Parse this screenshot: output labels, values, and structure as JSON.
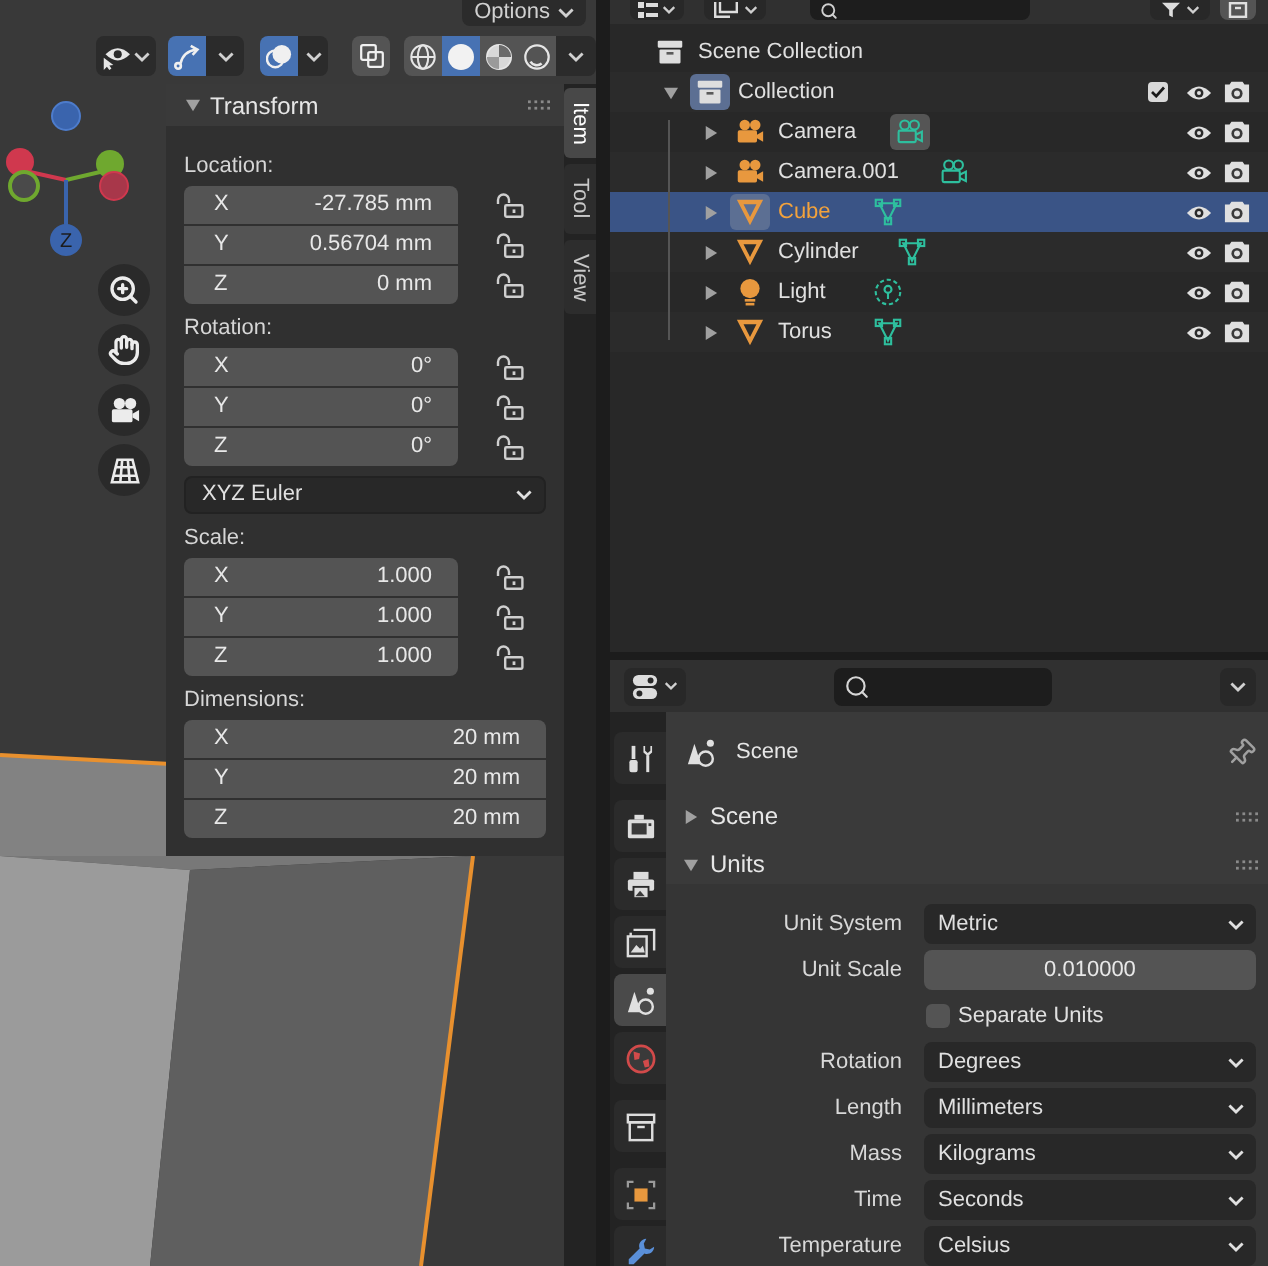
{
  "viewport": {
    "options_label": "Options",
    "toolbar": {
      "gizmo_on": true,
      "overlay_on": true,
      "xray_on": false,
      "shading": [
        {
          "kind": "wireframe",
          "selected": false
        },
        {
          "kind": "solid",
          "selected": true
        },
        {
          "kind": "material",
          "selected": false
        },
        {
          "kind": "rendered",
          "selected": false
        }
      ]
    },
    "gizmo": {
      "z_label": "Z"
    },
    "nav_buttons": [
      {
        "kind": "zoom"
      },
      {
        "kind": "pan"
      },
      {
        "kind": "camera"
      },
      {
        "kind": "ortho"
      }
    ],
    "sidebar_tabs": [
      {
        "label": "Item",
        "selected": true
      },
      {
        "label": "Tool",
        "selected": false
      },
      {
        "label": "View",
        "selected": false
      }
    ],
    "transform_panel": {
      "title": "Transform",
      "expanded": true,
      "sections": [
        {
          "kind": "vector",
          "label": "Location:",
          "fields": [
            {
              "axis": "X",
              "value": "-27.785 mm",
              "locked": false
            },
            {
              "axis": "Y",
              "value": "0.56704 mm",
              "locked": false
            },
            {
              "axis": "Z",
              "value": "0 mm",
              "locked": false
            }
          ]
        },
        {
          "kind": "vector",
          "label": "Rotation:",
          "fields": [
            {
              "axis": "X",
              "value": "0°",
              "locked": false
            },
            {
              "axis": "Y",
              "value": "0°",
              "locked": false
            },
            {
              "axis": "Z",
              "value": "0°",
              "locked": false
            }
          ]
        },
        {
          "kind": "dropdown",
          "value": "XYZ Euler"
        },
        {
          "kind": "vector",
          "label": "Scale:",
          "fields": [
            {
              "axis": "X",
              "value": "1.000",
              "locked": false
            },
            {
              "axis": "Y",
              "value": "1.000",
              "locked": false
            },
            {
              "axis": "Z",
              "value": "1.000",
              "locked": false
            }
          ]
        },
        {
          "kind": "vector",
          "label": "Dimensions:",
          "fields": [
            {
              "axis": "X",
              "value": "20 mm"
            },
            {
              "axis": "Y",
              "value": "20 mm"
            },
            {
              "axis": "Z",
              "value": "20 mm"
            }
          ]
        }
      ]
    }
  },
  "outliner": {
    "tree": [
      {
        "name": "Scene Collection",
        "kind": "scene_collection",
        "selected": false,
        "children": [
          {
            "name": "Collection",
            "kind": "collection",
            "expanded": true,
            "selected": false,
            "active": true,
            "checked": true,
            "visible": true,
            "renderable": true,
            "children": [
              {
                "name": "Camera",
                "kind": "camera",
                "expanded": false,
                "selected": false,
                "active": false,
                "data_active": true,
                "visible": true,
                "renderable": true
              },
              {
                "name": "Camera.001",
                "kind": "camera",
                "expanded": false,
                "selected": false,
                "active": false,
                "data_active": false,
                "visible": true,
                "renderable": true
              },
              {
                "name": "Cube",
                "kind": "mesh",
                "expanded": false,
                "selected": true,
                "active": true,
                "data_active": false,
                "visible": true,
                "renderable": true
              },
              {
                "name": "Cylinder",
                "kind": "mesh",
                "expanded": false,
                "selected": false,
                "active": false,
                "data_active": false,
                "visible": true,
                "renderable": true
              },
              {
                "name": "Light",
                "kind": "light",
                "expanded": false,
                "selected": false,
                "active": false,
                "data_active": false,
                "visible": true,
                "renderable": true
              },
              {
                "name": "Torus",
                "kind": "mesh",
                "expanded": false,
                "selected": false,
                "active": false,
                "data_active": false,
                "visible": true,
                "renderable": true
              }
            ]
          }
        ]
      }
    ]
  },
  "properties": {
    "tab_groups": [
      {
        "tabs": [
          {
            "kind": "tool",
            "selected": false
          }
        ]
      },
      {
        "tabs": [
          {
            "kind": "render",
            "selected": false
          },
          {
            "kind": "output",
            "selected": false
          },
          {
            "kind": "view_layer",
            "selected": false
          },
          {
            "kind": "scene",
            "selected": true
          },
          {
            "kind": "world",
            "selected": false
          }
        ]
      },
      {
        "tabs": [
          {
            "kind": "collection",
            "selected": false
          }
        ]
      },
      {
        "tabs": [
          {
            "kind": "object",
            "selected": false
          },
          {
            "kind": "modifiers",
            "selected": false
          }
        ]
      }
    ],
    "context": {
      "title": "Scene"
    },
    "panels": [
      {
        "title": "Scene",
        "expanded": false
      },
      {
        "title": "Units",
        "expanded": true,
        "rows": [
          {
            "kind": "dropdown",
            "label": "Unit System",
            "value": "Metric"
          },
          {
            "kind": "number",
            "label": "Unit Scale",
            "value": "0.010000"
          },
          {
            "kind": "checkbox",
            "label": "Separate Units",
            "checked": false
          },
          {
            "kind": "dropdown",
            "label": "Rotation",
            "value": "Degrees"
          },
          {
            "kind": "dropdown",
            "label": "Length",
            "value": "Millimeters"
          },
          {
            "kind": "dropdown",
            "label": "Mass",
            "value": "Kilograms"
          },
          {
            "kind": "dropdown",
            "label": "Time",
            "value": "Seconds"
          },
          {
            "kind": "dropdown",
            "label": "Temperature",
            "value": "Celsius"
          }
        ]
      }
    ]
  }
}
